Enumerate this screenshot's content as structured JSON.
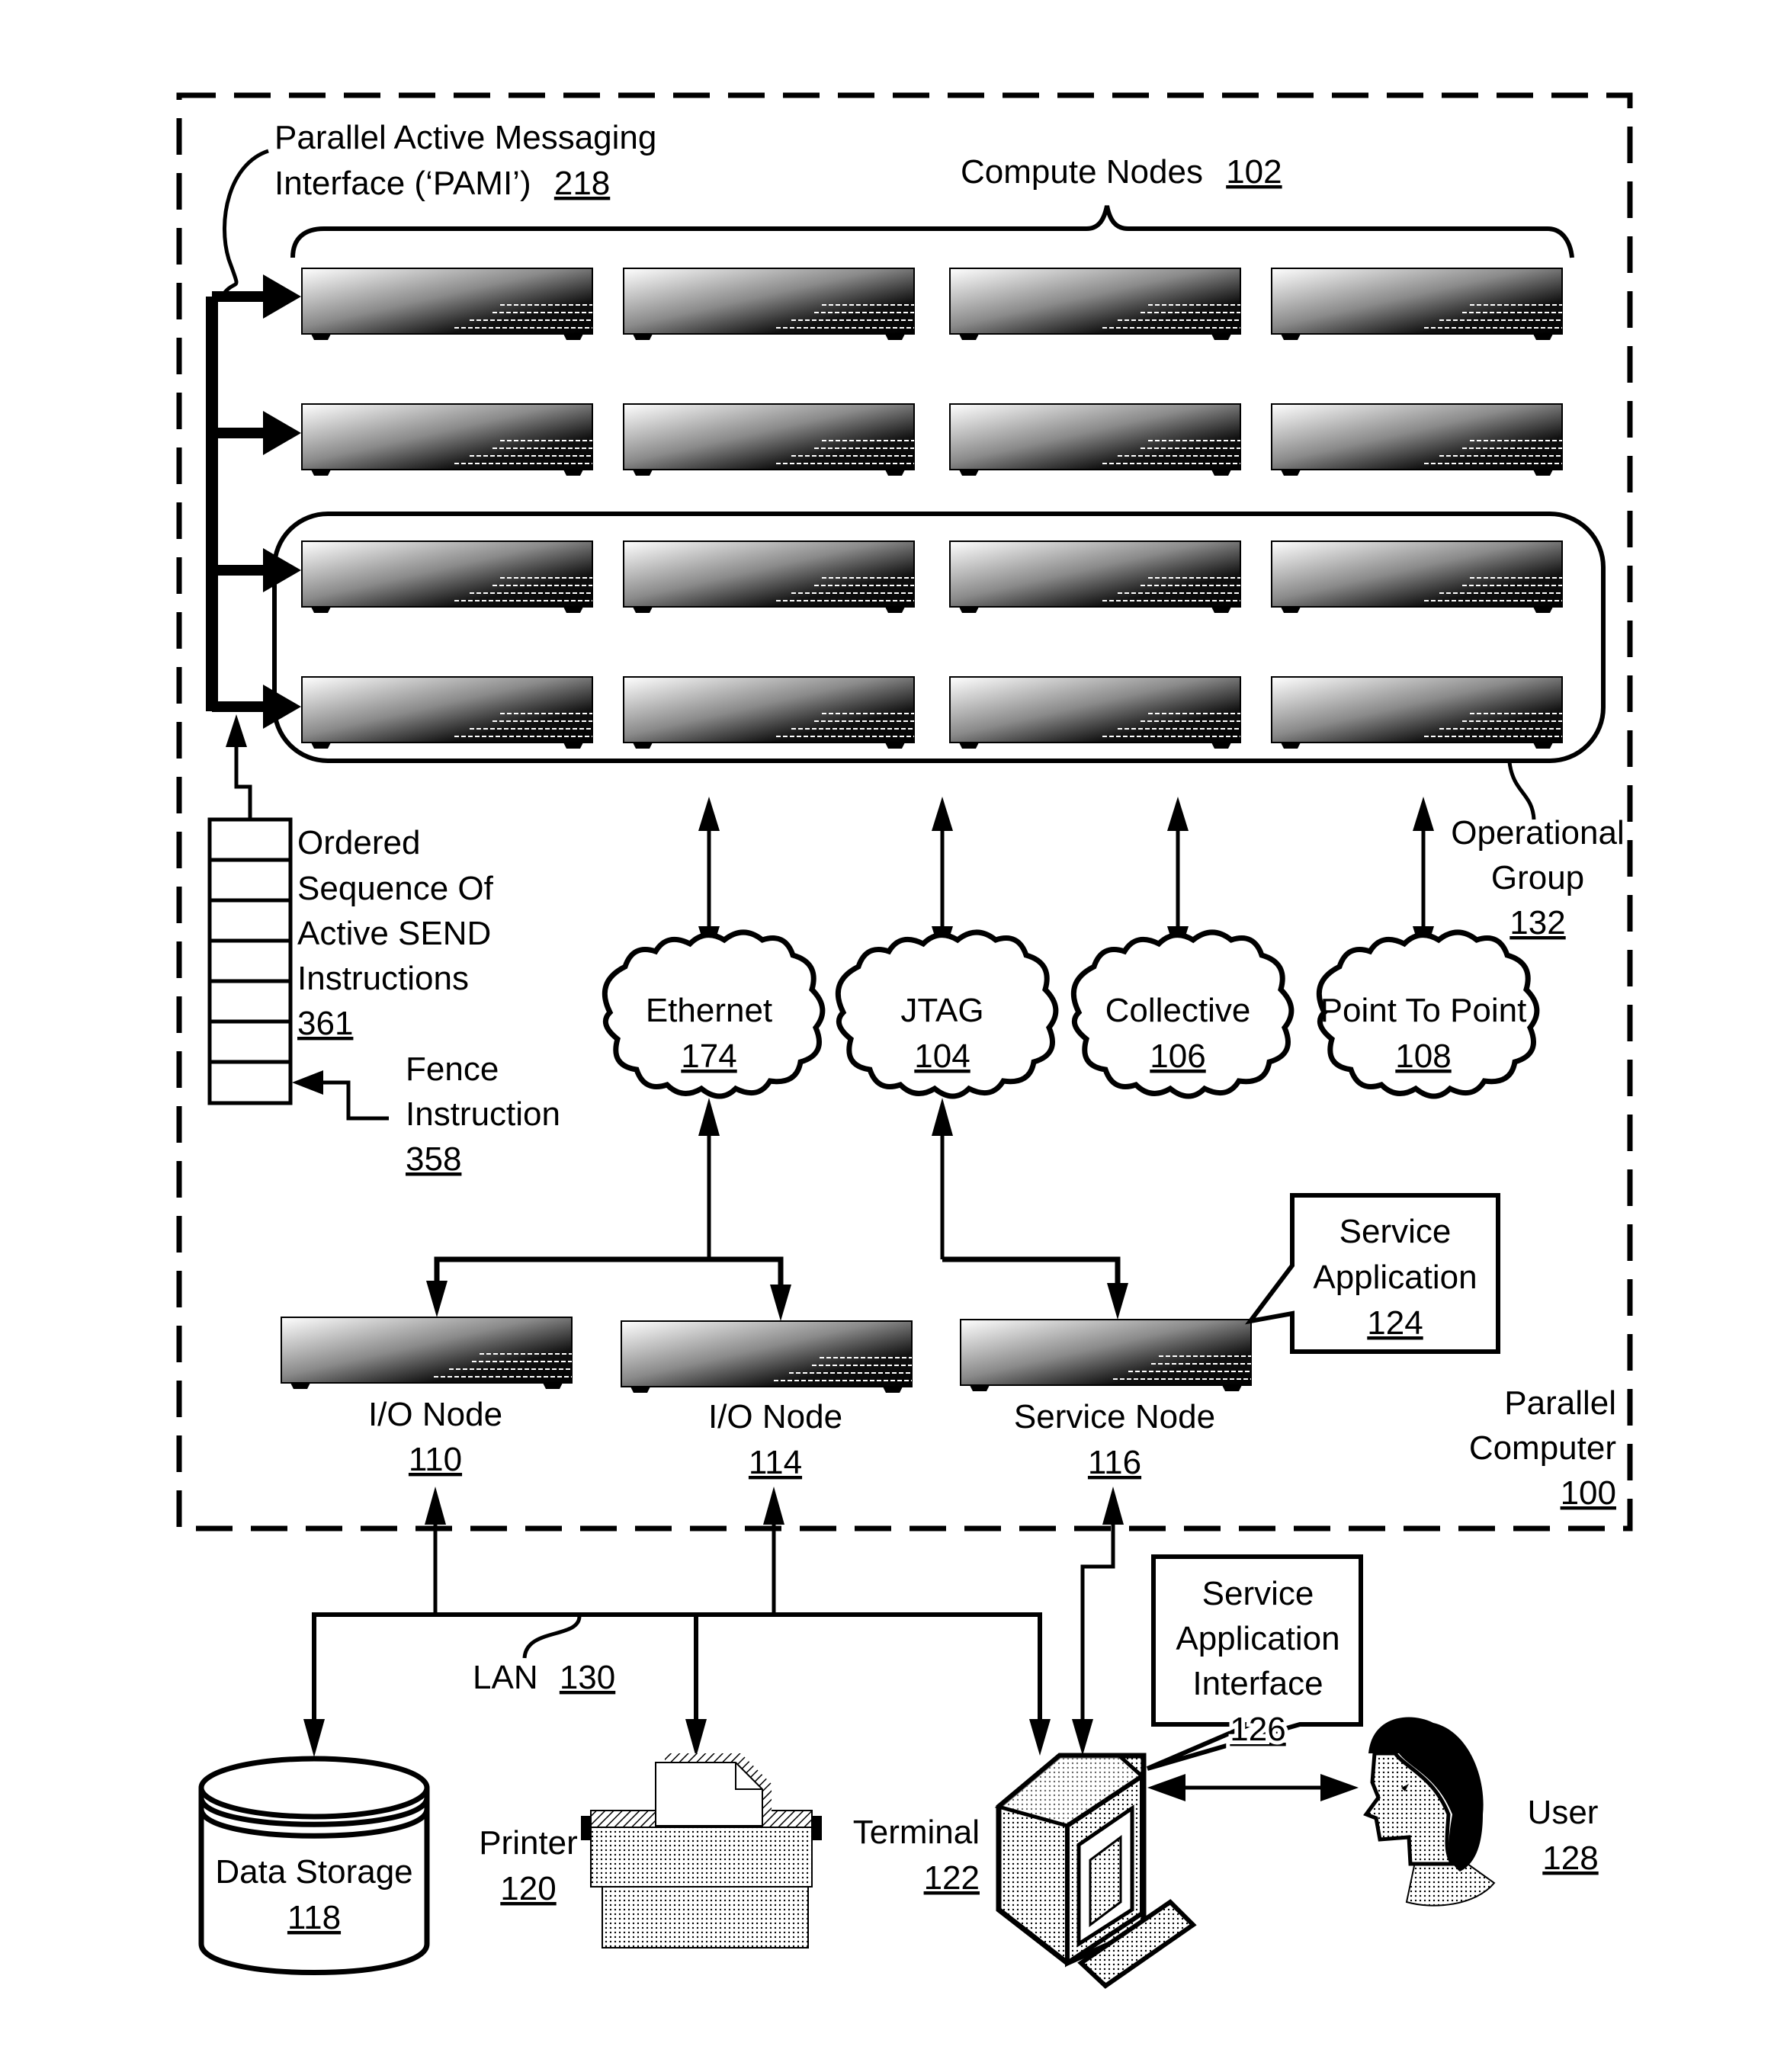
{
  "diagram": {
    "title": "Parallel Computer",
    "ref": "100",
    "colors": {
      "ink": "#000000",
      "background": "#ffffff"
    },
    "pami": {
      "line1": "Parallel Active Messaging",
      "line2": "Interface (‘PAMI’)",
      "ref": "218"
    },
    "compute_nodes": {
      "label": "Compute Nodes",
      "ref": "102",
      "rows": 4,
      "cols": 4
    },
    "operational_group": {
      "line1": "Operational",
      "line2": "Group",
      "ref": "132"
    },
    "ordered_sequence": {
      "lines": [
        "Ordered",
        "Sequence Of",
        "Active SEND",
        "Instructions"
      ],
      "ref": "361",
      "cells": 7
    },
    "fence_instruction": {
      "line1": "Fence",
      "line2": "Instruction",
      "ref": "358"
    },
    "networks": [
      {
        "label": "Ethernet",
        "ref": "174"
      },
      {
        "label": "JTAG",
        "ref": "104"
      },
      {
        "label": "Collective",
        "ref": "106"
      },
      {
        "label": "Point To Point",
        "ref": "108"
      }
    ],
    "io_nodes": [
      {
        "label": "I/O Node",
        "ref": "110"
      },
      {
        "label": "I/O Node",
        "ref": "114"
      }
    ],
    "service_node": {
      "label": "Service Node",
      "ref": "116"
    },
    "service_application": {
      "line1": "Service",
      "line2": "Application",
      "ref": "124"
    },
    "parallel_computer": {
      "line1": "Parallel",
      "line2": "Computer",
      "ref": "100"
    },
    "lan": {
      "label": "LAN",
      "ref": "130"
    },
    "data_storage": {
      "label": "Data Storage",
      "ref": "118"
    },
    "printer": {
      "label": "Printer",
      "ref": "120"
    },
    "terminal": {
      "label": "Terminal",
      "ref": "122"
    },
    "service_application_interface": {
      "line1": "Service",
      "line2": "Application",
      "line3": "Interface",
      "ref": "126"
    },
    "user": {
      "label": "User",
      "ref": "128"
    }
  }
}
